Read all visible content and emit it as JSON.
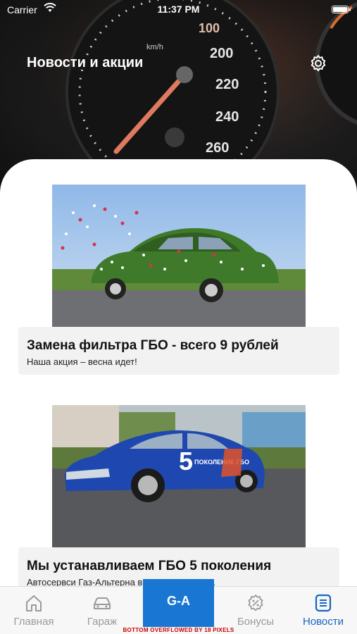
{
  "status_bar": {
    "carrier": "Carrier",
    "time": "11:37 PM"
  },
  "header": {
    "title": "Новости и акции"
  },
  "dashboard": {
    "ticks": [
      "100",
      "200",
      "220",
      "240",
      "260"
    ],
    "unit": "km/h"
  },
  "news": [
    {
      "title": "Замена фильтра ГБО - всего 9 рублей",
      "subtitle": "Наша акция – весна идет!"
    },
    {
      "title": "Мы устанавливаем ГБО 5 поколения",
      "subtitle": "Автосервси Газ-Альтерна              в Беларуси начи...",
      "car_text_big": "5",
      "car_text": "ПОКОЛЕНИЕ ГБО"
    }
  ],
  "tabs": [
    {
      "label": "Главная",
      "icon": "home-icon"
    },
    {
      "label": "Гараж",
      "icon": "car-icon"
    },
    {
      "label": "G-A",
      "icon": "logo"
    },
    {
      "label": "Бонусы",
      "icon": "bonus-icon"
    },
    {
      "label": "Новости",
      "icon": "news-icon",
      "active": true
    }
  ],
  "debug": {
    "overflow": "BOTTOM OVERFLOWED BY 18 PIXELS"
  },
  "colors": {
    "accent": "#1976d2",
    "active_tab": "#1565c0",
    "inactive_tab": "#9a9a9a",
    "gauge_needle": "#e07a5f"
  }
}
